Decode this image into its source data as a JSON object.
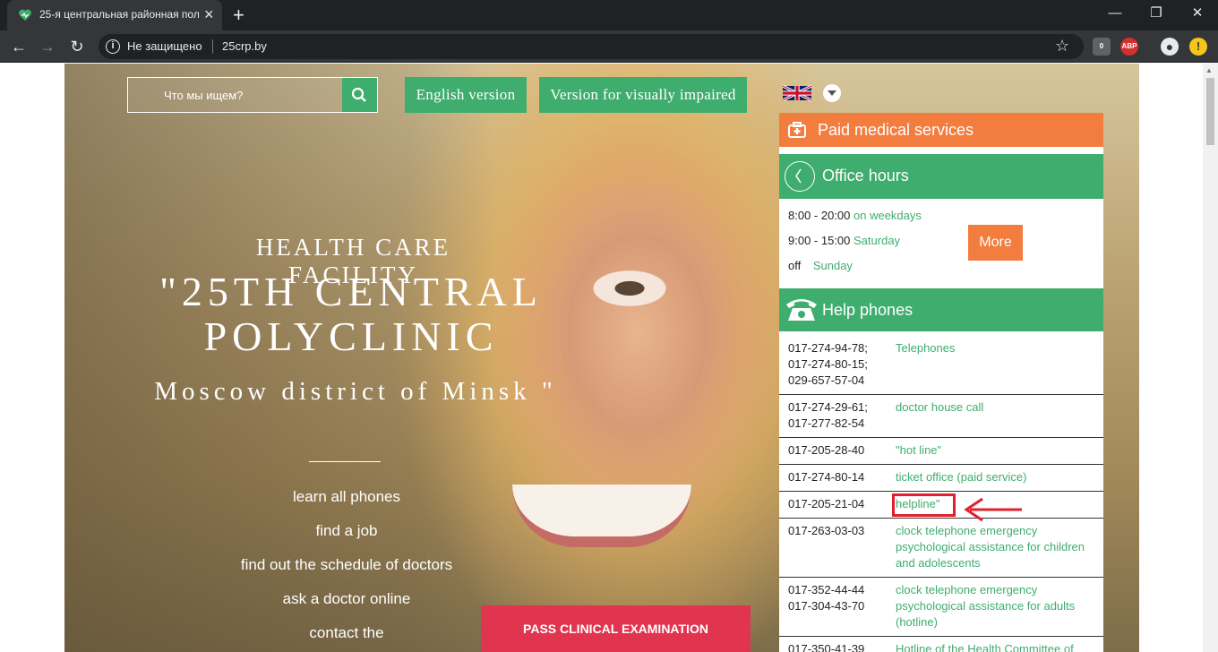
{
  "browser": {
    "tab_title": "25-я центральная районная пол",
    "new_tab": "+",
    "address": {
      "security_label": "Не защищено",
      "url": "25crp.by"
    },
    "ext_abp": "ABP",
    "ext_badge": "0"
  },
  "header": {
    "search_placeholder": "Что мы ищем?",
    "english_version": "English version",
    "visually_impaired": "Version for visually impaired"
  },
  "hero": {
    "title_line1": "HEALTH CARE FACILITY",
    "title_line2": "\"25TH CENTRAL POLYCLINIC",
    "title_line3": "Moscow district of Minsk \"",
    "links": [
      "learn all phones",
      "find a job",
      "find out the schedule of doctors",
      "ask a doctor online",
      "contact the"
    ],
    "exam_button": "PASS CLINICAL EXAMINATION"
  },
  "panel": {
    "paid_services": "Paid medical services",
    "office_hours": {
      "title": "Office hours",
      "rows": [
        {
          "time": "8:00 - 20:00",
          "day": "on weekdays"
        },
        {
          "time": "9:00 - 15:00",
          "day": "Saturday"
        },
        {
          "time": "off",
          "day": "Sunday"
        }
      ],
      "more": "More"
    },
    "help_phones": {
      "title": "Help phones",
      "rows": [
        {
          "numbers": "017-274-94-78;\n017-274-80-15;\n029-657-57-04",
          "desc": "Telephones"
        },
        {
          "numbers": "017-274-29-61;\n017-277-82-54",
          "desc": "doctor house call"
        },
        {
          "numbers": "017-205-28-40",
          "desc": "\"hot line\""
        },
        {
          "numbers": "017-274-80-14",
          "desc": "ticket office (paid service)"
        },
        {
          "numbers": "017-205-21-04",
          "desc": "helpline\""
        },
        {
          "numbers": "017-263-03-03",
          "desc": "clock telephone emergency psychological assistance for children and adolescents"
        },
        {
          "numbers": "017-352-44-44\n017-304-43-70",
          "desc": "clock telephone emergency psychological assistance for adults (hotline)"
        },
        {
          "numbers": "017-350-41-39",
          "desc": "Hotline of the Health Committee of"
        }
      ]
    }
  },
  "colors": {
    "green": "#3fad6e",
    "orange": "#f37d3e",
    "exam_red": "#e0344f",
    "annotation_red": "#e0202c"
  }
}
